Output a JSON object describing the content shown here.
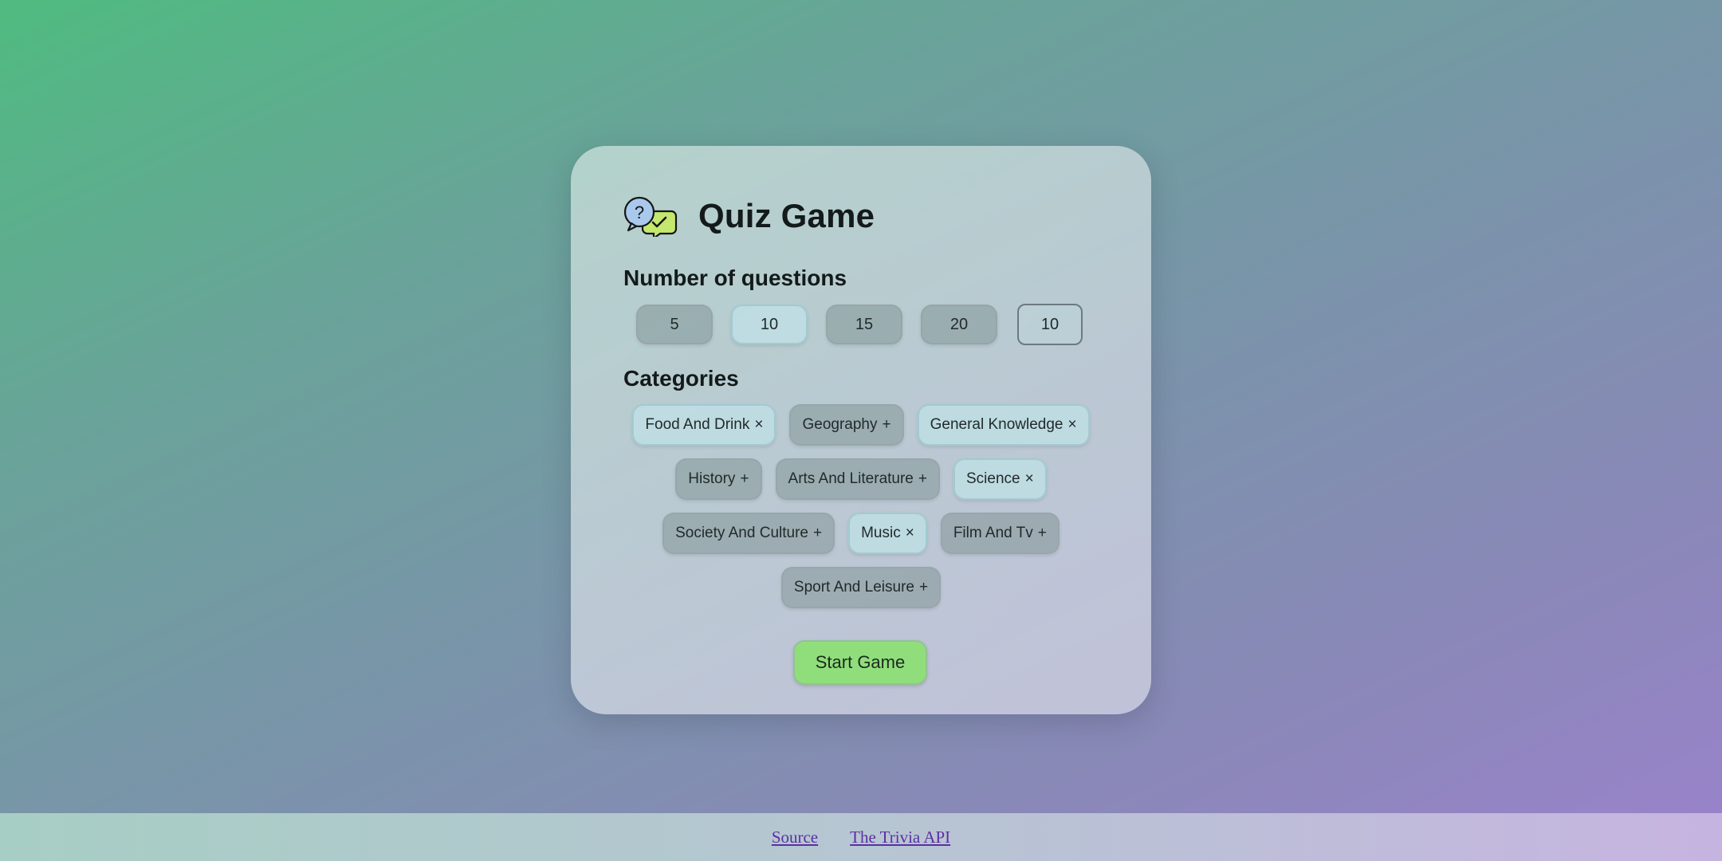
{
  "app": {
    "title": "Quiz Game",
    "logo_icon": "quiz-speech-bubbles-icon"
  },
  "questions": {
    "label": "Number of questions",
    "options": [
      "5",
      "10",
      "15",
      "20"
    ],
    "selected": "10",
    "custom_value": "10"
  },
  "categories": {
    "label": "Categories",
    "items": [
      {
        "label": "Food And Drink",
        "mark": "×",
        "selected": true
      },
      {
        "label": "Geography",
        "mark": "+",
        "selected": false
      },
      {
        "label": "General Knowledge",
        "mark": "×",
        "selected": true
      },
      {
        "label": "History",
        "mark": "+",
        "selected": false
      },
      {
        "label": "Arts And Literature",
        "mark": "+",
        "selected": false
      },
      {
        "label": "Science",
        "mark": "×",
        "selected": true
      },
      {
        "label": "Society And Culture",
        "mark": "+",
        "selected": false
      },
      {
        "label": "Music",
        "mark": "×",
        "selected": true
      },
      {
        "label": "Film And Tv",
        "mark": "+",
        "selected": false
      },
      {
        "label": "Sport And Leisure",
        "mark": "+",
        "selected": false
      }
    ]
  },
  "start_button": {
    "label": "Start Game",
    "color": "#8fde7b"
  },
  "footer": {
    "links": [
      "Source",
      "The Trivia API"
    ],
    "link_color": "#5c2fa3"
  }
}
